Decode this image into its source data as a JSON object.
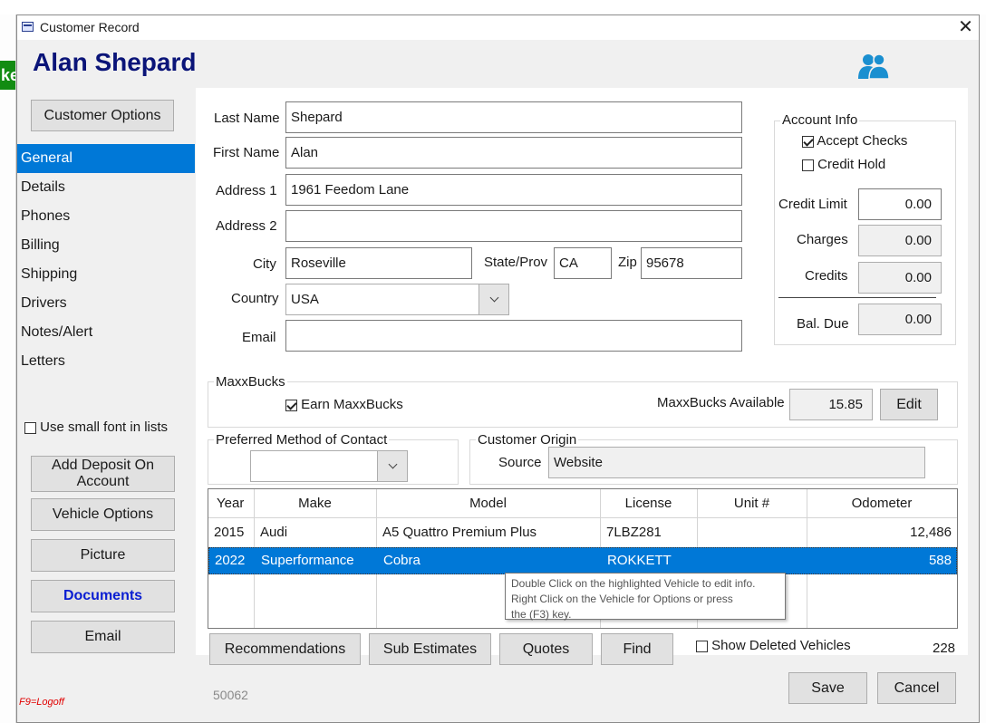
{
  "window": {
    "title": "Customer Record",
    "close_glyph": "✕"
  },
  "customer": {
    "name": "Alan Shepard"
  },
  "icons": {
    "title": "window-icon",
    "people": "contacts-icon",
    "accent": "#1a8fd0"
  },
  "left_panel": {
    "options_button": "Customer Options",
    "nav": [
      "General",
      "Details",
      "Phones",
      "Billing",
      "Shipping",
      "Drivers",
      "Notes/Alert",
      "Letters"
    ],
    "active_nav": "General",
    "small_font_label": "Use small font in lists",
    "small_font_checked": false,
    "buttons": [
      "Add Deposit On Account",
      "Vehicle Options",
      "Picture",
      "Documents",
      "Email"
    ],
    "logoff_hint": "F9=Logoff"
  },
  "form": {
    "last_name_label": "Last Name",
    "last_name_value": "Shepard",
    "first_name_label": "First Name",
    "first_name_value": "Alan",
    "address1_label": "Address 1",
    "address1_value": "1961 Feedom Lane",
    "address2_label": "Address 2",
    "address2_value": "",
    "city_label": "City",
    "city_value": "Roseville",
    "state_label": "State/Prov",
    "state_value": "CA",
    "zip_label": "Zip",
    "zip_value": "95678",
    "country_label": "Country",
    "country_value": "USA",
    "email_label": "Email",
    "email_value": ""
  },
  "account_info": {
    "caption": "Account Info",
    "accept_checks_label": "Accept Checks",
    "accept_checks_checked": true,
    "credit_hold_label": "Credit Hold",
    "credit_hold_checked": false,
    "credit_limit_label": "Credit Limit",
    "credit_limit_value": "0.00",
    "charges_label": "Charges",
    "charges_value": "0.00",
    "credits_label": "Credits",
    "credits_value": "0.00",
    "bal_due_label": "Bal. Due",
    "bal_due_value": "0.00"
  },
  "maxxbucks": {
    "caption": "MaxxBucks",
    "earn_label": "Earn MaxxBucks",
    "earn_checked": true,
    "available_label": "MaxxBucks Available",
    "available_value": "15.85",
    "edit_button": "Edit"
  },
  "contact": {
    "caption": "Preferred Method of Contact",
    "value": ""
  },
  "origin": {
    "caption": "Customer Origin",
    "source_label": "Source",
    "source_value": "Website"
  },
  "vehicles": {
    "columns": [
      "Year",
      "Make",
      "Model",
      "License",
      "Unit #",
      "Odometer"
    ],
    "rows": [
      {
        "year": "2015",
        "make": "Audi",
        "model": "A5 Quattro Premium Plus",
        "license": "7LBZ281",
        "unit": "",
        "odometer": "12,486"
      },
      {
        "year": "2022",
        "make": "Superformance",
        "model": "Cobra",
        "license": "ROKKETT",
        "unit": "",
        "odometer": "588"
      }
    ],
    "selected_row": 1
  },
  "tooltip": {
    "line1": "Double Click on the highlighted Vehicle to edit info.",
    "line2": "Right Click on the Vehicle for Options or press",
    "line3": "the (F3) key."
  },
  "bottom_bar": {
    "recommendations": "Recommendations",
    "sub_estimates": "Sub Estimates",
    "quotes": "Quotes",
    "find": "Find",
    "show_deleted_label": "Show Deleted Vehicles",
    "show_deleted_checked": false,
    "count": "228"
  },
  "footer": {
    "record_number": "50062",
    "save_button": "Save",
    "cancel_button": "Cancel"
  },
  "background_app": {
    "green_tab_text": "ke"
  }
}
